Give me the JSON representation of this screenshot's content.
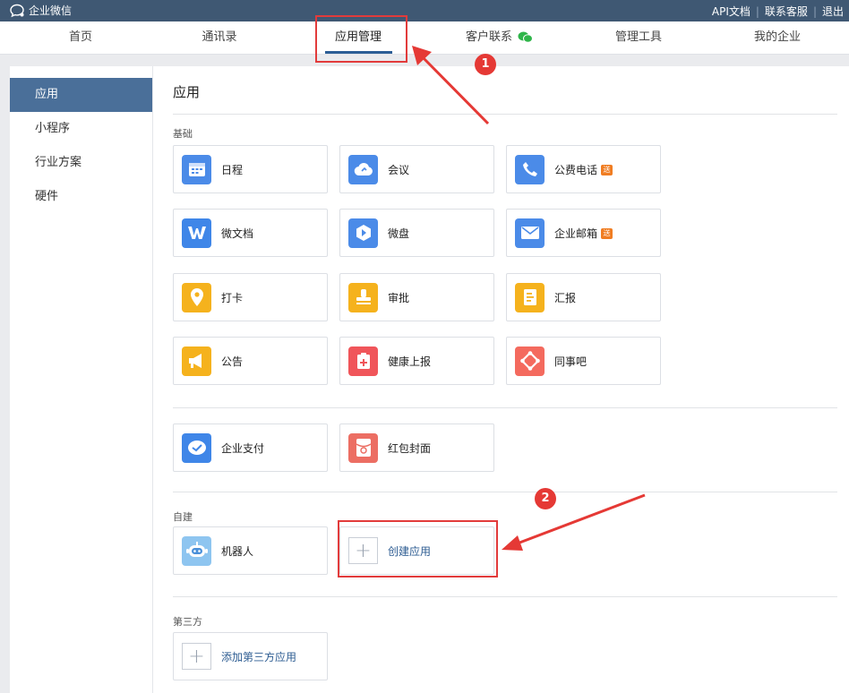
{
  "topbar": {
    "brand": "企业微信",
    "links": [
      "API文档",
      "联系客服",
      "退出"
    ]
  },
  "nav": {
    "tabs": [
      "首页",
      "通讯录",
      "应用管理",
      "客户联系",
      "管理工具",
      "我的企业"
    ],
    "active": "应用管理"
  },
  "sidebar": {
    "items": [
      "应用",
      "小程序",
      "行业方案",
      "硬件"
    ],
    "active": "应用"
  },
  "main": {
    "title": "应用",
    "basic_label": "基础",
    "basic_apps": [
      {
        "label": "日程",
        "icon": "calendar-icon",
        "color": "#4b8be8"
      },
      {
        "label": "会议",
        "icon": "cloud-meeting-icon",
        "color": "#4b8be8"
      },
      {
        "label": "公费电话",
        "icon": "phone-icon",
        "color": "#4b8be8",
        "tag": "送"
      },
      {
        "label": "微文档",
        "icon": "document-w-icon",
        "color": "#3f86e8"
      },
      {
        "label": "微盘",
        "icon": "drive-icon",
        "color": "#4b8be8"
      },
      {
        "label": "企业邮箱",
        "icon": "mail-icon",
        "color": "#4b8be8",
        "tag": "送"
      },
      {
        "label": "打卡",
        "icon": "location-pin-icon",
        "color": "#f5b21d"
      },
      {
        "label": "审批",
        "icon": "stamp-icon",
        "color": "#f5b21d"
      },
      {
        "label": "汇报",
        "icon": "report-icon",
        "color": "#f5b21d"
      },
      {
        "label": "公告",
        "icon": "megaphone-icon",
        "color": "#f5b21d"
      },
      {
        "label": "健康上报",
        "icon": "health-kit-icon",
        "color": "#f0555a"
      },
      {
        "label": "同事吧",
        "icon": "colleague-network-icon",
        "color": "#f46a5e"
      }
    ],
    "pay_apps": [
      {
        "label": "企业支付",
        "icon": "pay-check-icon",
        "color": "#3f86e8"
      },
      {
        "label": "红包封面",
        "icon": "red-envelope-icon",
        "color": "#ec6e63"
      }
    ],
    "custom_label": "自建",
    "custom_apps": [
      {
        "label": "机器人",
        "icon": "robot-icon",
        "color": "#8ec5f0"
      }
    ],
    "create_app_label": "创建应用",
    "third_label": "第三方",
    "add_third_label": "添加第三方应用"
  },
  "annotations": {
    "step1": "1",
    "step2": "2",
    "highlight_color": "#e23b3b"
  }
}
